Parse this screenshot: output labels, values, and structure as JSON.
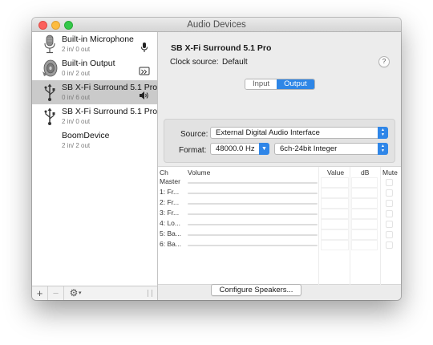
{
  "window": {
    "title": "Audio Devices"
  },
  "sidebar": {
    "devices": [
      {
        "name": "Built-in Microphone",
        "io": "2 in/ 0 out",
        "icon": "microphone-icon",
        "status_icon": "microphone-icon"
      },
      {
        "name": "Built-in Output",
        "io": "0 in/ 2 out",
        "icon": "speaker-icon",
        "status_icon": "display-port-icon"
      },
      {
        "name": "SB X-Fi Surround 5.1 Pro",
        "io": "0 in/ 6 out",
        "icon": "usb-icon",
        "status_icon": "speaker-volume-icon",
        "selected": true
      },
      {
        "name": "SB X-Fi Surround 5.1 Pro",
        "io": "2 in/ 0 out",
        "icon": "usb-icon"
      },
      {
        "name": "BoomDevice",
        "io": "2 in/ 2 out",
        "icon": ""
      }
    ],
    "footer": {
      "add": "+",
      "remove": "−",
      "gear": "⚙",
      "chevron": "▾"
    }
  },
  "main": {
    "device_title": "SB X-Fi Surround 5.1 Pro",
    "clock_label": "Clock source:",
    "clock_value": "Default",
    "help": "?",
    "tabs": [
      {
        "label": "Input"
      },
      {
        "label": "Output",
        "selected": true
      }
    ],
    "source_label": "Source:",
    "source_value": "External Digital Audio Interface",
    "format_label": "Format:",
    "format_rate": "48000.0 Hz",
    "format_depth": "6ch-24bit Integer",
    "table": {
      "headers": {
        "ch": "Ch",
        "volume": "Volume",
        "value": "Value",
        "db": "dB",
        "mute": "Mute"
      },
      "rows": [
        {
          "ch": "Master"
        },
        {
          "ch": "1: Fr..."
        },
        {
          "ch": "2: Fr..."
        },
        {
          "ch": "3: Fr..."
        },
        {
          "ch": "4: Lo..."
        },
        {
          "ch": "5: Ba..."
        },
        {
          "ch": "6: Ba..."
        }
      ]
    },
    "configure_button": "Configure Speakers..."
  },
  "colors": {
    "accent": "#2e86e6",
    "selection": "#cacaca",
    "close": "#fc605c",
    "minimize": "#fdbc40",
    "maximize": "#34c84a"
  }
}
